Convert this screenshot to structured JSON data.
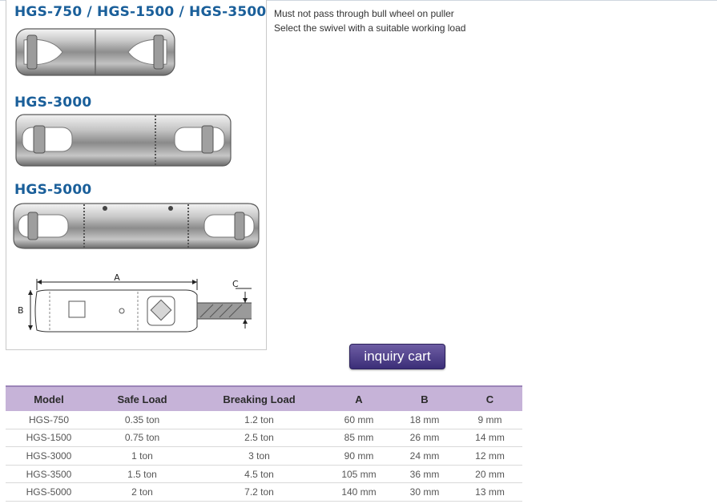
{
  "images": {
    "titles": [
      "HGS-750 / HGS-1500 / HGS-3500",
      "HGS-3000",
      "HGS-5000"
    ],
    "drawing_labels": {
      "a": "A",
      "b": "B",
      "c": "C"
    }
  },
  "description": {
    "line1": "Must not pass through bull wheel on puller",
    "line2": "Select the swivel with a suitable working load"
  },
  "inquiry_button": "inquiry cart",
  "table": {
    "headers": [
      "Model",
      "Safe Load",
      "Breaking Load",
      "A",
      "B",
      "C"
    ],
    "rows": [
      [
        "HGS-750",
        "0.35 ton",
        "1.2 ton",
        "60 mm",
        "18 mm",
        "9 mm"
      ],
      [
        "HGS-1500",
        "0.75 ton",
        "2.5 ton",
        "85 mm",
        "26 mm",
        "14 mm"
      ],
      [
        "HGS-3000",
        "1 ton",
        "3 ton",
        "90 mm",
        "24 mm",
        "12 mm"
      ],
      [
        "HGS-3500",
        "1.5 ton",
        "4.5 ton",
        "105 mm",
        "36 mm",
        "20 mm"
      ],
      [
        "HGS-5000",
        "2 ton",
        "7.2 ton",
        "140 mm",
        "30 mm",
        "13 mm"
      ]
    ]
  },
  "colors": {
    "title_blue": "#1a5f9a",
    "header_purple": "#c6b3d8",
    "button_purple": "#4a3d8a"
  }
}
